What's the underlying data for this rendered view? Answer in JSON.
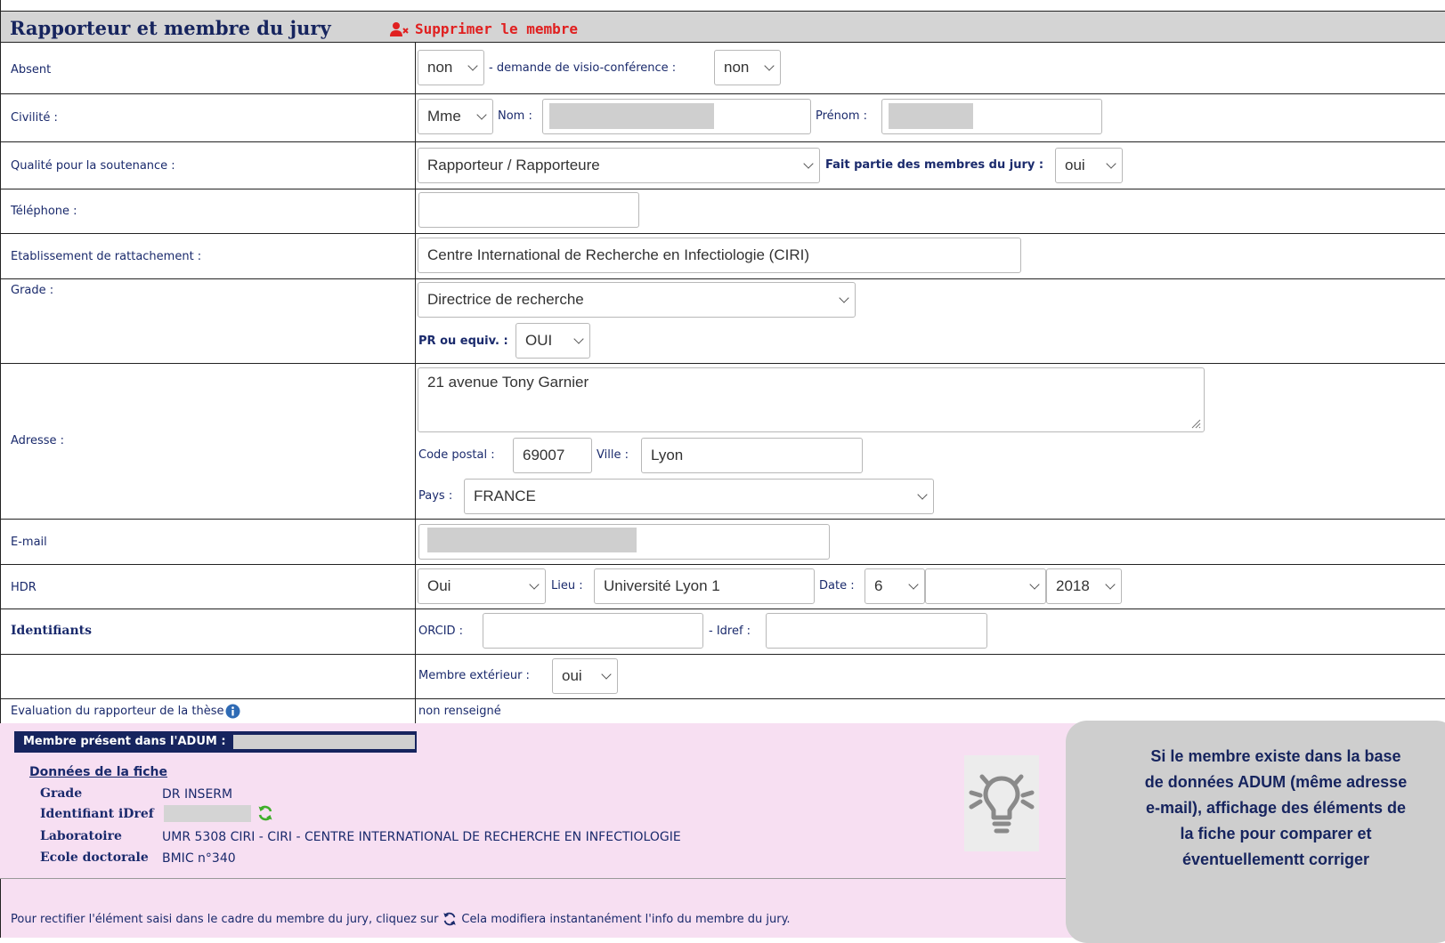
{
  "header": {
    "title": "Rapporteur et membre du jury",
    "delete_label": "Supprimer le membre"
  },
  "form": {
    "absent": {
      "label": "Absent",
      "value": "non",
      "visio_label": "- demande de visio-conférence :",
      "visio_value": "non"
    },
    "civilite": {
      "label": "Civilité :",
      "value": "Mme",
      "nom_label": "Nom :",
      "prenom_label": "Prénom :"
    },
    "qualite": {
      "label": "Qualité pour la soutenance :",
      "value": "Rapporteur / Rapporteure",
      "jury_label": "Fait partie des membres du jury :",
      "jury_value": "oui"
    },
    "telephone": {
      "label": "Téléphone :",
      "value": ""
    },
    "etablissement": {
      "label": "Etablissement de rattachement :",
      "value": "Centre International de Recherche en Infectiologie (CIRI)"
    },
    "grade": {
      "label": "Grade :",
      "value": "Directrice de recherche",
      "pr_label": "PR ou equiv. :",
      "pr_value": "OUI"
    },
    "adresse": {
      "label": "Adresse :",
      "value": "21 avenue Tony Garnier",
      "cp_label": "Code postal :",
      "cp_value": "69007",
      "ville_label": "Ville :",
      "ville_value": "Lyon",
      "pays_label": "Pays :",
      "pays_value": "FRANCE"
    },
    "email": {
      "label": "E-mail"
    },
    "hdr": {
      "label": "HDR",
      "value": "Oui",
      "lieu_label": "Lieu :",
      "lieu_value": "Université Lyon 1",
      "date_label": "Date :",
      "day_value": "6",
      "month_value": "",
      "year_value": "2018"
    },
    "identifiants": {
      "label": "Identifiants",
      "orcid_label": "ORCID :",
      "orcid_value": "",
      "idref_label": "- Idref :",
      "idref_value": ""
    },
    "exterieur": {
      "label": "Membre extérieur :",
      "value": "oui"
    },
    "evaluation": {
      "label": "Evaluation du rapporteur de la thèse",
      "value": "non renseigné"
    }
  },
  "adum": {
    "title": "Membre présent dans l'ADUM :",
    "fiche_link": "Données de la fiche",
    "rows": [
      {
        "key": "Grade",
        "value": "DR INSERM"
      },
      {
        "key": "Identifiant iDref",
        "value": ""
      },
      {
        "key": "Laboratoire",
        "value": "UMR 5308 CIRI - CIRI - CENTRE INTERNATIONAL DE RECHERCHE EN INFECTIOLOGIE"
      },
      {
        "key": "Ecole doctorale",
        "value": "BMIC n°340"
      }
    ],
    "footer_before": "Pour rectifier l'élément saisi dans le cadre du membre du jury, cliquez sur",
    "footer_after": "Cela modifiera instantanément l'info du membre du jury."
  },
  "tip": {
    "lines": [
      "Si le membre existe dans la base",
      "de données ADUM (même adresse",
      "e-mail), affichage des éléments de",
      "la fiche pour comparer et",
      "éventuellementt corriger"
    ]
  },
  "colors": {
    "header_bg": "#d4d4d4",
    "title_navy": "#16245e",
    "delete_red": "#e02020",
    "adum_bg": "#f7dff2",
    "refresh_green": "#3fae2a",
    "info_blue": "#2f6bb5"
  },
  "icons": [
    "delete-user-icon",
    "info-icon",
    "refresh-icon",
    "lightbulb-icon",
    "chevron-down-icon",
    "resize-grip-icon"
  ]
}
